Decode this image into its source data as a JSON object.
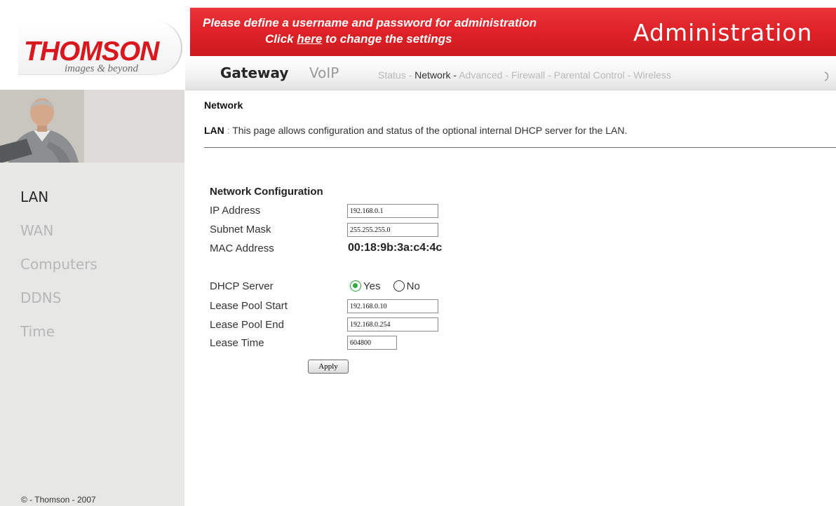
{
  "brand": {
    "name": "THOMSON",
    "tagline": "images & beyond"
  },
  "banner": {
    "message_line1": "Please define a username and password for administration",
    "message_line2_prefix": "Click",
    "message_link": "here",
    "message_line2_suffix": "to change the settings",
    "title": "Administration"
  },
  "nav": {
    "main_tabs": [
      "Gateway",
      "VoIP"
    ],
    "sub_tabs": [
      "Status",
      "Network",
      "Advanced",
      "Firewall",
      "Parental Control",
      "Wireless"
    ],
    "separator": "-",
    "active_sub_tab": "Network"
  },
  "sidebar": {
    "items": [
      "LAN",
      "WAN",
      "Computers",
      "DDNS",
      "Time"
    ],
    "active_item": "LAN",
    "copyright": "© - Thomson - 2007"
  },
  "page": {
    "title": "Network",
    "desc_label": "LAN",
    "desc_separator": ":",
    "description": "This page allows configuration and status of the optional internal DHCP server for the LAN."
  },
  "form": {
    "section_title": "Network Configuration",
    "ip_address": {
      "label": "IP Address",
      "value": "192.168.0.1"
    },
    "subnet_mask": {
      "label": "Subnet Mask",
      "value": "255.255.255.0"
    },
    "mac_address": {
      "label": "MAC Address",
      "value": "00:18:9b:3a:c4:4c"
    },
    "dhcp_server": {
      "label": "DHCP Server",
      "options": [
        "Yes",
        "No"
      ],
      "selected": "Yes"
    },
    "lease_pool_start": {
      "label": "Lease Pool Start",
      "value": "192.168.0.10"
    },
    "lease_pool_end": {
      "label": "Lease Pool End",
      "value": "192.168.0.254"
    },
    "lease_time": {
      "label": "Lease Time",
      "value": "604800"
    },
    "apply_label": "Apply"
  },
  "colors": {
    "banner_red": "#e02328",
    "brand_red": "#d8171f",
    "sidebar_bg": "#e7e7e6",
    "radio_selected": "#2fa83c"
  },
  "icons": {
    "dhcp_radio_selected": "radio-checked-icon",
    "dhcp_radio_unselected": "radio-unchecked-icon"
  }
}
